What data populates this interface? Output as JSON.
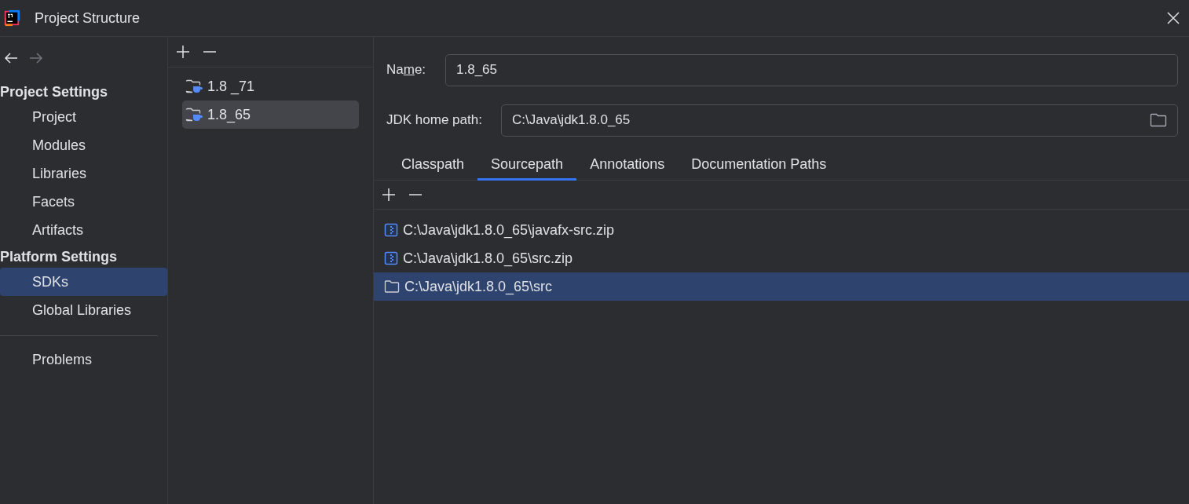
{
  "window": {
    "title": "Project Structure"
  },
  "sidebar": {
    "sections": [
      {
        "heading": "Project Settings",
        "items": [
          {
            "label": "Project",
            "selected": false
          },
          {
            "label": "Modules",
            "selected": false
          },
          {
            "label": "Libraries",
            "selected": false
          },
          {
            "label": "Facets",
            "selected": false
          },
          {
            "label": "Artifacts",
            "selected": false
          }
        ]
      },
      {
        "heading": "Platform Settings",
        "items": [
          {
            "label": "SDKs",
            "selected": true
          },
          {
            "label": "Global Libraries",
            "selected": false
          }
        ]
      }
    ],
    "footer_items": [
      {
        "label": "Problems",
        "selected": false
      }
    ]
  },
  "sdk_list": [
    {
      "label": "1.8 _71",
      "selected": false
    },
    {
      "label": "1.8_65",
      "selected": true
    }
  ],
  "name_field": {
    "label_parts": [
      {
        "text": "Na",
        "underlined": false
      },
      {
        "text": "m",
        "underlined": true
      },
      {
        "text": "e:",
        "underlined": false
      }
    ],
    "value": "1.8_65"
  },
  "jdk_home_field": {
    "label": "JDK home path:",
    "value": "C:\\Java\\jdk1.8.0_65"
  },
  "tabs": [
    {
      "label": "Classpath",
      "selected": false
    },
    {
      "label": "Sourcepath",
      "selected": true
    },
    {
      "label": "Annotations",
      "selected": false
    },
    {
      "label": "Documentation Paths",
      "selected": false
    }
  ],
  "paths": [
    {
      "kind": "archive",
      "label": "C:\\Java\\jdk1.8.0_65\\javafx-src.zip",
      "selected": false
    },
    {
      "kind": "archive",
      "label": "C:\\Java\\jdk1.8.0_65\\src.zip",
      "selected": false
    },
    {
      "kind": "folder",
      "label": "C:\\Java\\jdk1.8.0_65\\src",
      "selected": true
    }
  ]
}
